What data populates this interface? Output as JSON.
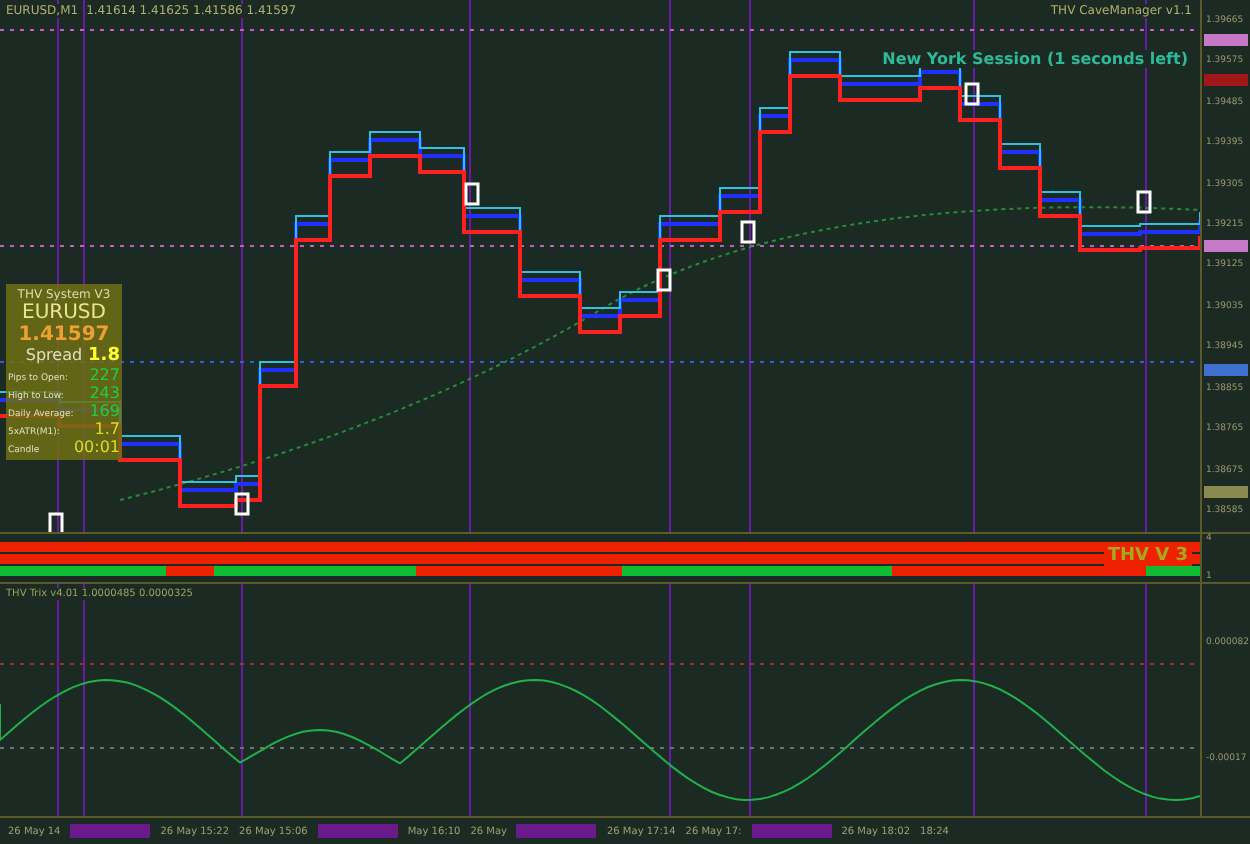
{
  "chart_header": {
    "symbol": "EURUSD,M1",
    "quotes": "1.41614 1.41625 1.41586 1.41597",
    "expert": "THV CaveManager v1.1"
  },
  "session_note": "New York Session (1 seconds left)",
  "info_panel": {
    "title": "THV System V3",
    "symbol": "EURUSD",
    "price": "1.41597",
    "spread_label": "Spread",
    "spread": "1.8",
    "rows": [
      {
        "label": "Pips to Open:",
        "value": "227",
        "color": "#22cc44"
      },
      {
        "label": "High to Low:",
        "value": "243",
        "color": "#22cc44"
      },
      {
        "label": "Daily Average:",
        "value": "169",
        "color": "#22cc44"
      },
      {
        "label": "5xATR(M1):",
        "value": "1.7",
        "color": "#dddd22"
      },
      {
        "label": "Candle",
        "value": "00:01",
        "color": "#dddd22"
      }
    ]
  },
  "price_axis": [
    "1.39665",
    "1.39575",
    "1.39485",
    "1.39395",
    "1.39305",
    "1.39215",
    "1.39125",
    "1.39035",
    "1.38945",
    "1.38855",
    "1.38765",
    "1.38675",
    "1.38585"
  ],
  "price_markers": [
    {
      "color": "#c878c8"
    },
    {
      "color": "#a01818"
    },
    {
      "color": "#c878c8"
    },
    {
      "color": "#4070d0"
    },
    {
      "color": "#8a8a50"
    }
  ],
  "signal_strip": {
    "label": "THV V 3",
    "axis": [
      "4",
      "1"
    ],
    "rows": [
      [
        {
          "color": "#ee2200"
        }
      ],
      [
        {
          "color": "#ee2200"
        }
      ],
      [
        {
          "color": "#11bb33"
        },
        {
          "color": "#ee2200"
        },
        {
          "color": "#11bb33"
        },
        {
          "color": "#ee2200"
        },
        {
          "color": "#11bb33"
        },
        {
          "color": "#ee2200"
        },
        {
          "color": "#11bb33"
        }
      ]
    ]
  },
  "oscillator": {
    "label": "THV Trix v4.01 1.0000485 0.0000325",
    "axis": [
      "0.000082",
      "-0.00017"
    ]
  },
  "time_axis": [
    "26 May 14",
    "26 May 15:22",
    "26 May 15:06",
    "May 16:10",
    "26 May",
    "26 May 17:14",
    "26 May 17:",
    "26 May 18:02",
    "18:24"
  ]
}
